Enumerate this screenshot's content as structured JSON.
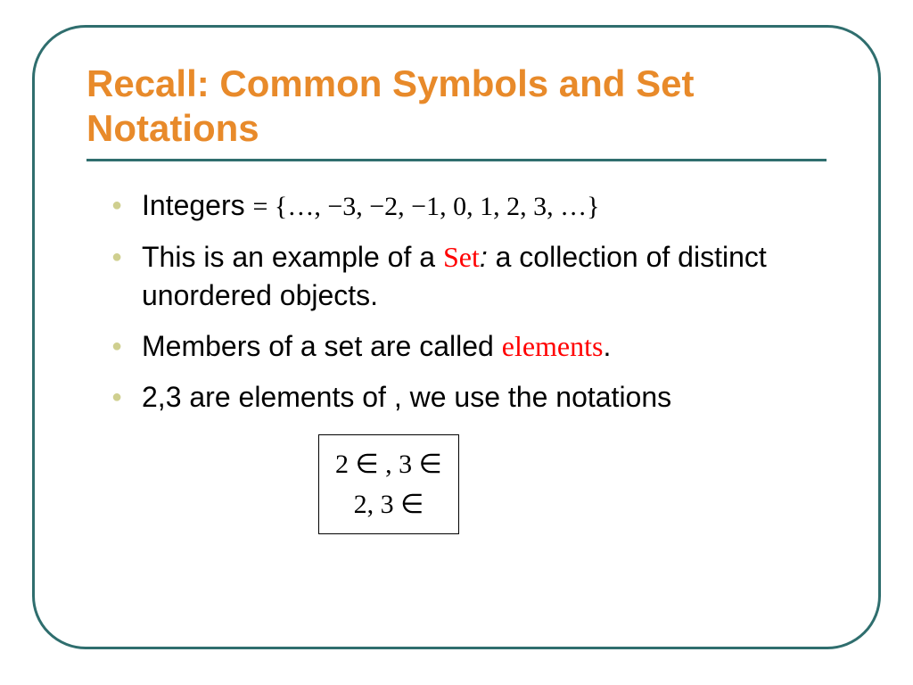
{
  "title": "Recall: Common Symbols and Set Notations",
  "bullets": {
    "b1_label": "Integers",
    "b1_math": "  = {…, −3, −2, −1, 0, 1, 2, 3, …}",
    "b2_pre": "This is an example of a ",
    "b2_term": "Set",
    "b2_colon": ": ",
    "b2_post": "a collection of distinct unordered objects.",
    "b3_pre": "Members of a set are called ",
    "b3_term": "elements",
    "b3_post": ".",
    "b4_pre": "2,3 are elements of ",
    "b4_sym": "",
    "b4_post": " , we use the notations"
  },
  "mathbox": {
    "row1": "2 ∈  ,   3 ∈ ",
    "row2": "2, 3 ∈ "
  }
}
